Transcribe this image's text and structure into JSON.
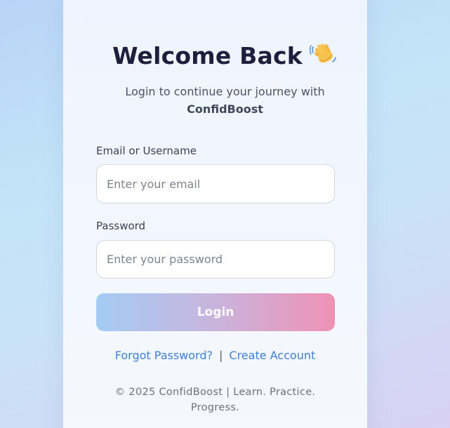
{
  "login": {
    "title": "Welcome Back",
    "title_emoji": "waving-hand-icon",
    "subtitle_prefix": "Login to continue your journey with",
    "brand": "ConfidBoost",
    "email_label": "Email or Username",
    "email_placeholder": "Enter your email",
    "email_value": "",
    "password_label": "Password",
    "password_placeholder": "Enter your password",
    "password_value": "",
    "submit_label": "Login",
    "forgot_link": "Forgot Password?",
    "separator": "|",
    "create_link": "Create Account",
    "footer": "© 2025 ConfidBoost | Learn. Practice. Progress."
  },
  "colors": {
    "title": "#1e1f3d",
    "link": "#3d80d9",
    "button_gradient_start": "#a4ccf4",
    "button_gradient_end": "#ee92b4"
  }
}
